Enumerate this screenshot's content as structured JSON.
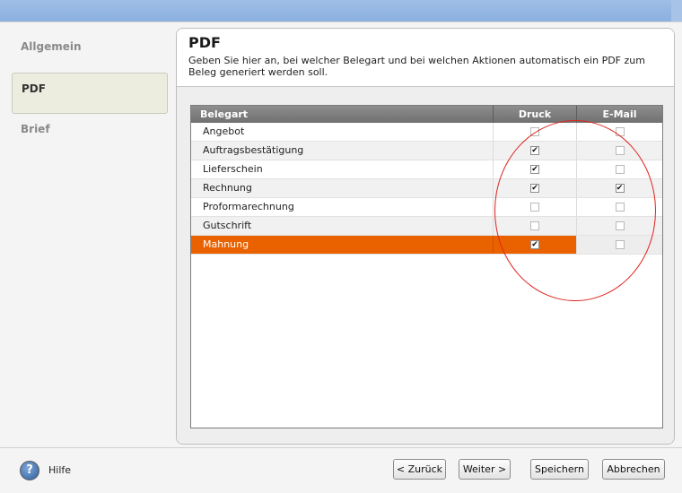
{
  "sidebar": {
    "items": [
      {
        "label": "Allgemein",
        "active": false
      },
      {
        "label": "PDF",
        "active": true
      },
      {
        "label": "Brief",
        "active": false
      }
    ]
  },
  "panel": {
    "title": "PDF",
    "description": "Geben Sie hier an, bei welcher Belegart und bei welchen Aktionen automatisch ein  PDF zum Beleg generiert werden soll."
  },
  "grid": {
    "columns": {
      "name": "Belegart",
      "druck": "Druck",
      "email": "E-Mail"
    },
    "rows": [
      {
        "name": "Angebot",
        "druck": false,
        "email": false
      },
      {
        "name": "Auftragsbestätigung",
        "druck": true,
        "email": false
      },
      {
        "name": "Lieferschein",
        "druck": true,
        "email": false
      },
      {
        "name": "Rechnung",
        "druck": true,
        "email": true
      },
      {
        "name": "Proformarechnung",
        "druck": false,
        "email": false
      },
      {
        "name": "Gutschrift",
        "druck": false,
        "email": false
      },
      {
        "name": "Mahnung",
        "druck": true,
        "email": false,
        "selected": true
      }
    ],
    "selected_color": "#ea6200"
  },
  "annotation": {
    "color": "#e0231d",
    "shape": "ellipse"
  },
  "footer": {
    "help_icon": "help-question-icon",
    "help_label": "Hilfe",
    "back_label": "< Zurück",
    "next_label": "Weiter >",
    "save_label": "Speichern",
    "cancel_label": "Abbrechen"
  }
}
